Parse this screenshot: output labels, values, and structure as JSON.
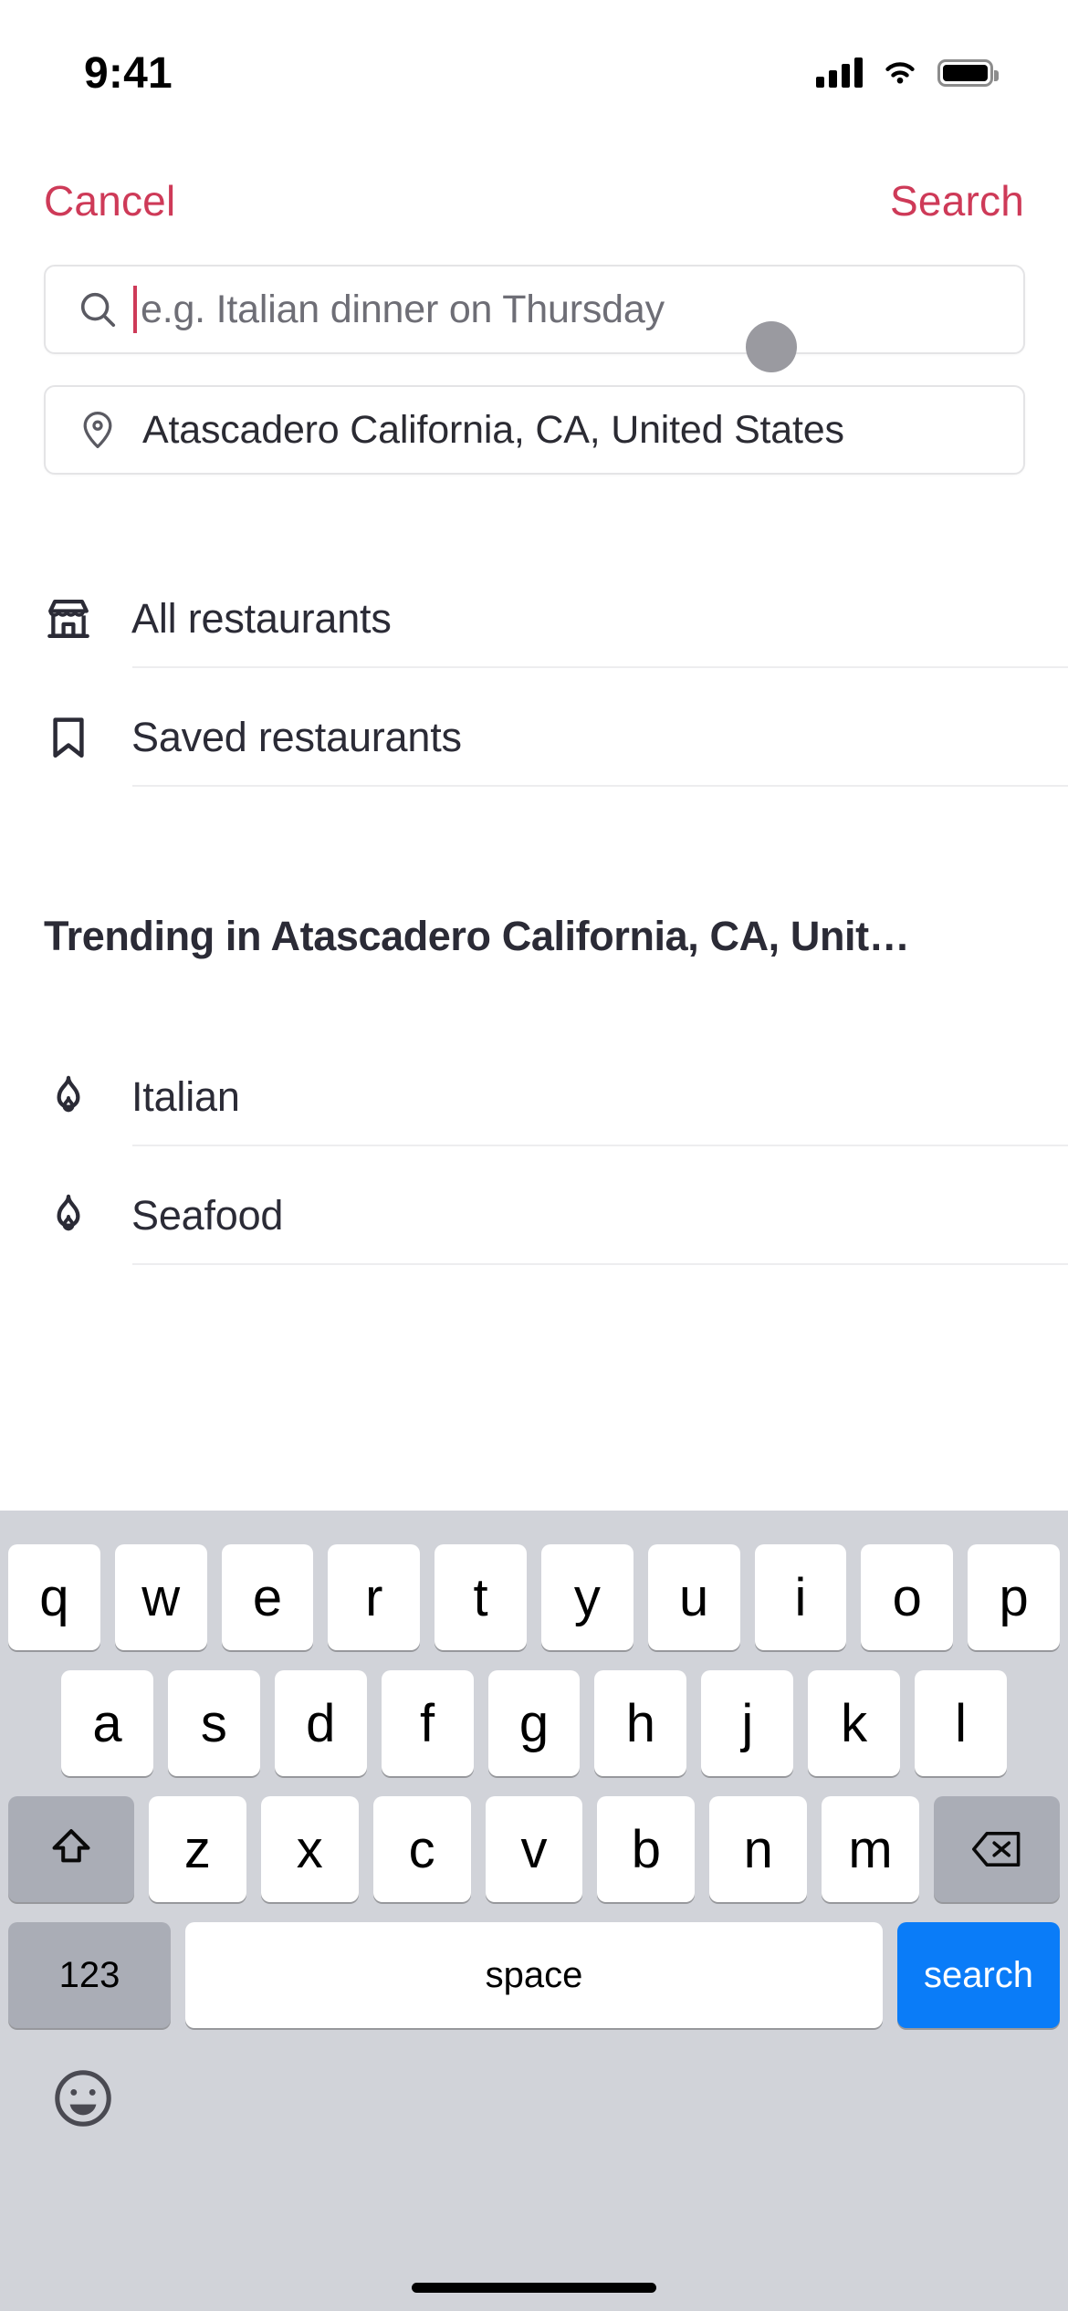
{
  "status_bar": {
    "time": "9:41",
    "cellular_icon": "signal-bars-icon",
    "wifi_icon": "wifi-icon",
    "battery_icon": "battery-icon"
  },
  "nav_bar": {
    "cancel_label": "Cancel",
    "search_label": "Search",
    "accent_color": "#CE3A58"
  },
  "search": {
    "icon": "search-icon",
    "value": "",
    "placeholder": "e.g. Italian dinner on Thursday",
    "caret_color": "#CE3A58"
  },
  "location": {
    "icon": "map-pin-icon",
    "value": "Atascadero California, CA, United States"
  },
  "quick_links": [
    {
      "label": "All restaurants",
      "icon": "storefront-icon"
    },
    {
      "label": "Saved restaurants",
      "icon": "bookmark-icon"
    }
  ],
  "trending": {
    "title": "Trending in Atascadero California, CA, Unit…",
    "items": [
      {
        "label": "Italian",
        "icon": "flame-icon"
      },
      {
        "label": "Seafood",
        "icon": "flame-icon"
      }
    ]
  },
  "keyboard": {
    "row1": [
      "q",
      "w",
      "e",
      "r",
      "t",
      "y",
      "u",
      "i",
      "o",
      "p"
    ],
    "row2": [
      "a",
      "s",
      "d",
      "f",
      "g",
      "h",
      "j",
      "k",
      "l"
    ],
    "row3": [
      "z",
      "x",
      "c",
      "v",
      "b",
      "n",
      "m"
    ],
    "shift_icon": "shift-arrow-icon",
    "delete_icon": "backspace-icon",
    "numeric_label": "123",
    "space_label": "space",
    "return_label": "search",
    "emoji_icon": "emoji-smiley-icon",
    "return_key_color": "#0A7CF8",
    "background_color": "#D1D3D9"
  }
}
